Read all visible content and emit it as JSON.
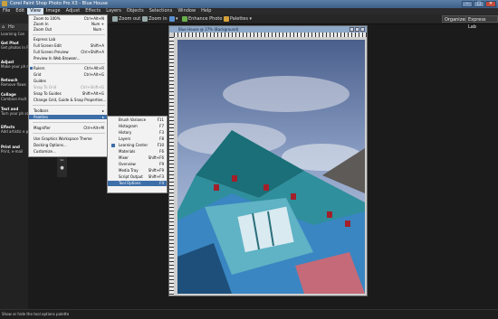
{
  "window": {
    "title": "Corel Paint Shop Photo Pro X3 - Blue House",
    "buttons": [
      "–",
      "□",
      "✕"
    ]
  },
  "menubar": [
    "File",
    "Edit",
    "View",
    "Image",
    "Adjust",
    "Effects",
    "Layers",
    "Objects",
    "Selections",
    "Window",
    "Help"
  ],
  "toolbar": {
    "zoom_out": "Zoom out",
    "zoom_in": "Zoom in",
    "enhance": "Enhance Photo",
    "palettes": "Palettes",
    "organizer": "Organizer",
    "express_lab": "Express Lab"
  },
  "left_panel": {
    "head": "Ho",
    "learning": "Learning Cen",
    "items": [
      {
        "title": "Get Phot",
        "desc": "Get photos in PC, or scann"
      },
      {
        "title": "Adjust",
        "desc": "Make your ph more sure"
      },
      {
        "title": "Retouch",
        "desc": "Remove flaws"
      },
      {
        "title": "Collage",
        "desc": "Combine mult"
      },
      {
        "title": "Text and",
        "desc": "Turn your ph so they comes"
      },
      {
        "title": "Effects",
        "desc": "Add artistic e photos"
      },
      {
        "title": "Print and",
        "desc": "Print, e-mail"
      }
    ]
  },
  "view_menu": {
    "items": [
      {
        "label": "Zoom to 100%",
        "shortcut": "Ctrl+Alt+N"
      },
      {
        "label": "Zoom In",
        "shortcut": "Num +"
      },
      {
        "label": "Zoom Out",
        "shortcut": "Num -"
      },
      {
        "label": "Express Lab",
        "shortcut": ""
      },
      {
        "label": "Full Screen Edit",
        "shortcut": "Shift+A"
      },
      {
        "label": "Full Screen Preview",
        "shortcut": "Ctrl+Shift+A"
      },
      {
        "label": "Preview In Web Browser...",
        "shortcut": ""
      },
      {
        "label": "Rulers",
        "shortcut": "Ctrl+Alt+R"
      },
      {
        "label": "Grid",
        "shortcut": "Ctrl+Alt+G"
      },
      {
        "label": "Guides",
        "shortcut": ""
      },
      {
        "label": "Snap To Grid",
        "shortcut": "Ctrl+Shift+G"
      },
      {
        "label": "Snap To Guides",
        "shortcut": "Shift+Alt+G"
      },
      {
        "label": "Change Grid, Guide & Snap Properties...",
        "shortcut": ""
      },
      {
        "label": "Toolbars",
        "shortcut": ""
      },
      {
        "label": "Palettes",
        "shortcut": ""
      },
      {
        "label": "Magnifier",
        "shortcut": "Ctrl+Alt+M"
      },
      {
        "label": "Use Graphics Workspace Theme",
        "shortcut": ""
      },
      {
        "label": "Docking Options...",
        "shortcut": ""
      },
      {
        "label": "Customize...",
        "shortcut": ""
      }
    ]
  },
  "palettes_submenu": {
    "items": [
      {
        "label": "Brush Variance",
        "shortcut": "F11"
      },
      {
        "label": "Histogram",
        "shortcut": "F7"
      },
      {
        "label": "History",
        "shortcut": "F3"
      },
      {
        "label": "Layers",
        "shortcut": "F8"
      },
      {
        "label": "Learning Center",
        "shortcut": "F10"
      },
      {
        "label": "Materials",
        "shortcut": "F6"
      },
      {
        "label": "Mixer",
        "shortcut": "Shift+F6"
      },
      {
        "label": "Overview",
        "shortcut": "F9"
      },
      {
        "label": "Media Tray",
        "shortcut": "Shift+F9"
      },
      {
        "label": "Script Output",
        "shortcut": "Shift+F3"
      },
      {
        "label": "Tool Options",
        "shortcut": "F4"
      }
    ]
  },
  "image_window": {
    "title": "Blue House @ 27% (Background)"
  },
  "statusbar": {
    "text": "Show or hide the tool options palette"
  }
}
